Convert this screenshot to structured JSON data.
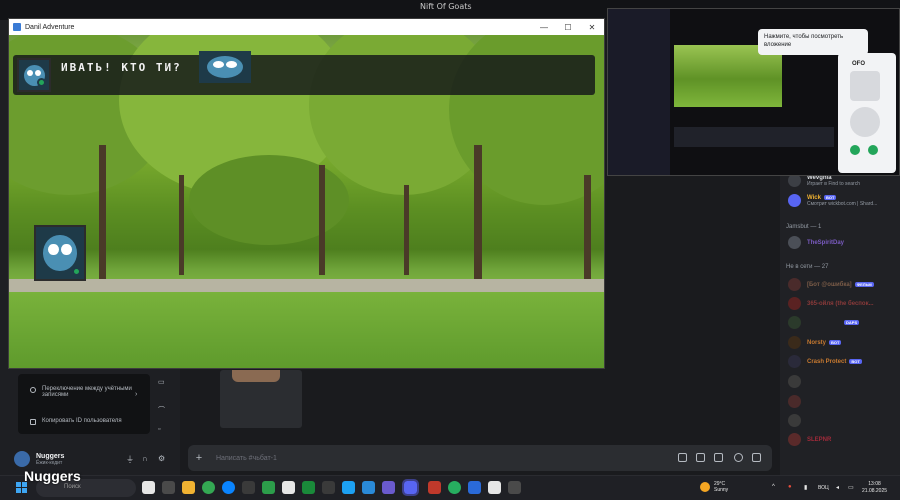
{
  "desktop": {
    "topbar_title": "Nift Of Goats"
  },
  "game_window": {
    "title": "Danil Adventure",
    "controls": [
      "—",
      "☐",
      "✕"
    ],
    "dialog_text": "ИВАТЬ! КТО ТИ?"
  },
  "context_menu": {
    "items": [
      {
        "label": "Переключение между учётными записями",
        "icon": "switch-accounts-icon"
      },
      {
        "label": "Копировать ID пользователя",
        "icon": "copy-id-icon"
      }
    ]
  },
  "user_panel": {
    "name": "Nuggers",
    "status": "Ёжик-кедит"
  },
  "message_input": {
    "placeholder": "Написать #чьбат-1"
  },
  "member_list": {
    "top_members": [
      {
        "name": "Wevgnia",
        "sub": "Играет в Find to search",
        "color": "#dbdee1",
        "avatar": "#3c3f45"
      },
      {
        "name": "Wick",
        "sub": "Смотрит wickbot.com | Shard...",
        "badge": "BOT",
        "color": "#f0b232",
        "avatar": "#5865f2"
      }
    ],
    "section_online": "Jamsbut — 1",
    "online_member": {
      "name": "TheSpiritDay",
      "color": "#7a5bc0",
      "avatar": "#4b4f57"
    },
    "section_offline": "Не в сети — 27",
    "offline_members": [
      {
        "name": "[Бот @ошибка]",
        "badge": "ФЕЛЬМ",
        "color": "#7b5c48",
        "avatar": "#4a2b2b"
      },
      {
        "name": "365-ойля (the беспок...",
        "color": "#8a3a3a",
        "avatar": "#5a2222"
      },
      {
        "name": "",
        "badge": "DAPS",
        "color": "#7a7a7a",
        "avatar": "#2b3a2b"
      },
      {
        "name": "Norsty",
        "badge": "BOT",
        "color": "#c87a30",
        "avatar": "#3a2a1a"
      },
      {
        "name": "Crash Protect",
        "badge": "BOT",
        "color": "#c87a30",
        "avatar": "#2a2a3a"
      },
      {
        "name": "",
        "color": "#6b4a4a",
        "avatar": "#3a3a3a"
      },
      {
        "name": "",
        "color": "#6b2a2a",
        "avatar": "#4a2a2a"
      },
      {
        "name": "",
        "color": "#6b4a4a",
        "avatar": "#3a3a3a"
      },
      {
        "name": "SLEPNR",
        "color": "#a02a3a",
        "avatar": "#5a2a2a"
      }
    ]
  },
  "stream_pip": {
    "tooltip": "Нажмите, чтобы посмотреть вложение",
    "card_name": "OFO"
  },
  "taskbar": {
    "overlay_label": "Nuggers",
    "search_placeholder": "Поиск",
    "weather_temp": "29°C",
    "weather_desc": "Sunny",
    "lang": "ВОЦ",
    "time": "13:08",
    "date": "21.08.2025"
  }
}
